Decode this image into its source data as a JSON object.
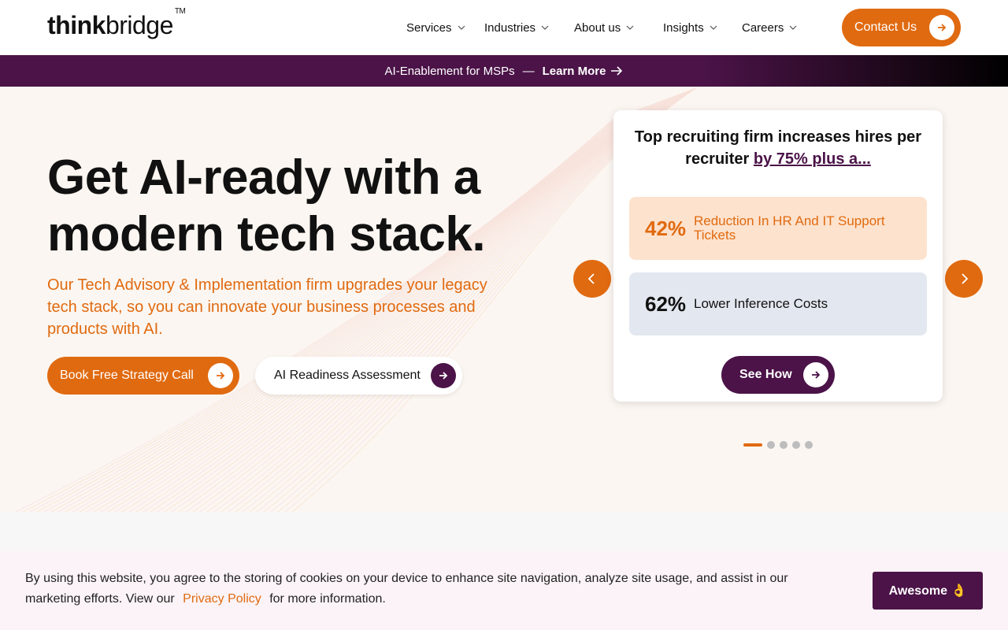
{
  "header": {
    "logo_bold": "think",
    "logo_light": "bridge",
    "logo_tm": "TM",
    "nav": [
      {
        "label": "Services"
      },
      {
        "label": "Industries"
      },
      {
        "label": "About us"
      },
      {
        "label": "Insights"
      },
      {
        "label": "Careers"
      }
    ],
    "contact_label": "Contact Us"
  },
  "banner": {
    "text": "AI-Enablement for MSPs",
    "dash": "—",
    "link": "Learn More"
  },
  "hero": {
    "title_line1": "Get AI-ready with a",
    "title_line2": "modern tech stack.",
    "subtitle": "Our Tech Advisory & Implementation firm upgrades your legacy tech stack, so you can innovate your business processes and products with AI.",
    "primary_cta": "Book Free Strategy Call",
    "secondary_cta": "AI Readiness Assessment"
  },
  "card": {
    "title": "Top recruiting firm increases hires per recruiter",
    "title_link": "by 75% plus a...",
    "stats": [
      {
        "value": "42%",
        "label": "Reduction In HR And IT Support Tickets"
      },
      {
        "value": "62%",
        "label": "Lower Inference Costs"
      }
    ],
    "cta": "See How"
  },
  "carousel": {
    "slide_count": 5,
    "active_index": 0
  },
  "cookie": {
    "text_before": "By using this website, you agree to the storing of cookies on your device to enhance site navigation, analyze site usage, and assist in our marketing efforts. View our",
    "policy_link": "Privacy Policy",
    "text_after": "for more information.",
    "accept_label": "Awesome 👌"
  },
  "colors": {
    "accent": "#e06a10",
    "brand": "#4b1348"
  }
}
